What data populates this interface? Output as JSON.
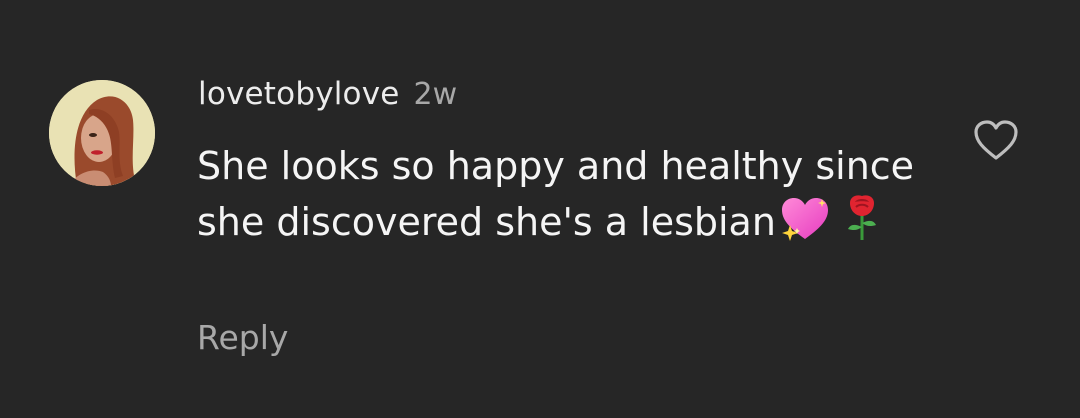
{
  "comment": {
    "username": "lovetobylove",
    "time": "2w",
    "text": "She looks so happy and healthy since she discovered she's a lesbian",
    "emojis": [
      "sparkling-heart-emoji",
      "rose-emoji"
    ],
    "reply_label": "Reply",
    "like_icon": "heart-outline-icon",
    "avatar_icon": "user-avatar"
  },
  "colors": {
    "background": "#262626",
    "primary_text": "#f5f5f5",
    "secondary_text": "#a8a8a8"
  }
}
